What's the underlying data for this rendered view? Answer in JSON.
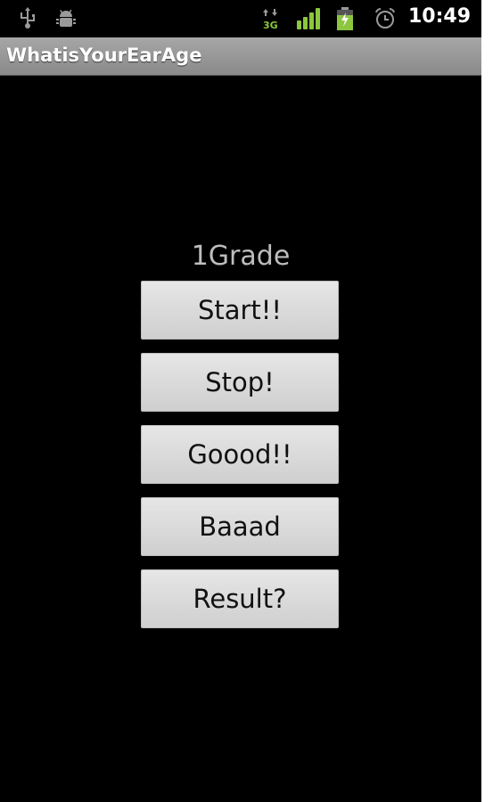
{
  "status_bar": {
    "icons": [
      "usb-icon",
      "android-debug-icon",
      "3g-data-icon",
      "signal-icon",
      "battery-charging-icon",
      "alarm-icon"
    ],
    "time": "10:49",
    "accent_color": "#8cc63f"
  },
  "app": {
    "title": "WhatisYourEarAge"
  },
  "main": {
    "grade_label": "1Grade",
    "buttons": [
      {
        "label": "Start!!"
      },
      {
        "label": "Stop!"
      },
      {
        "label": "Goood!!"
      },
      {
        "label": "Baaad"
      },
      {
        "label": "Result?"
      }
    ]
  }
}
